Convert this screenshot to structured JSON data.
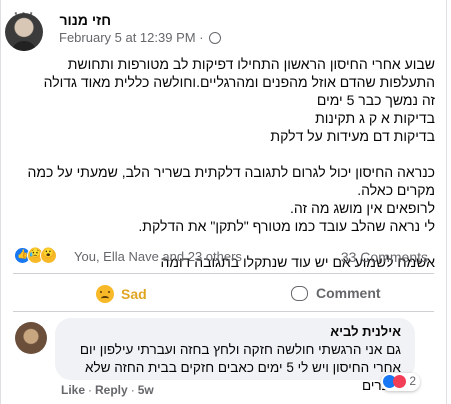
{
  "post": {
    "author": "חזי מנור",
    "date": "February 5 at 12:39 PM",
    "more_label": "···",
    "paragraphs": [
      "שבוע אחרי החיסון הראשון התחילו דפיקות לב מטורפות ותחושת התעלפות שהדם אוזל מהפנים ומהרגליים.וחולשה כללית מאוד גדולה",
      "זה נמשך כבר 5 ימים",
      "בדיקות א ק ג תקינות",
      "בדיקות דם מעידות על דלקת",
      "",
      "כנראה החיסון יכול לגרום לתגובה דלקתית בשריר הלב, שמעתי על כמה מקרים כאלה.",
      "לרופאים אין מושג מה זה.",
      "לי נראה שהלב עובד כמו מטורף \"לתקן\" את הדלקת.",
      "",
      "אשמח לשמוע אם יש עוד שנתקלו בתגובה דומה"
    ],
    "reactions": {
      "types": [
        "like-icon",
        "sad-icon",
        "wow-icon"
      ],
      "names": "You, Ella Nave and 23 others"
    },
    "comment_count": "33 Comments",
    "actions": {
      "sad_label": "Sad",
      "comment_label": "Comment"
    }
  },
  "comment": {
    "author": "אילנית לביא",
    "text": "גם אני הרגשתי חולשה חזקה ולחץ בחזה ועברתי עילפון יום אחרי החיסון ויש לי 5 ימים כאבים חזקים בבית החזה שלא עוברים",
    "reaction_count": "2",
    "like_label": "Like",
    "separator": "·",
    "reply_label": "Reply",
    "separator2": "·",
    "time_label": "5w"
  },
  "colors": {
    "accent": "#1877f2",
    "sad": "#e0a523",
    "muted": "#65676b"
  }
}
